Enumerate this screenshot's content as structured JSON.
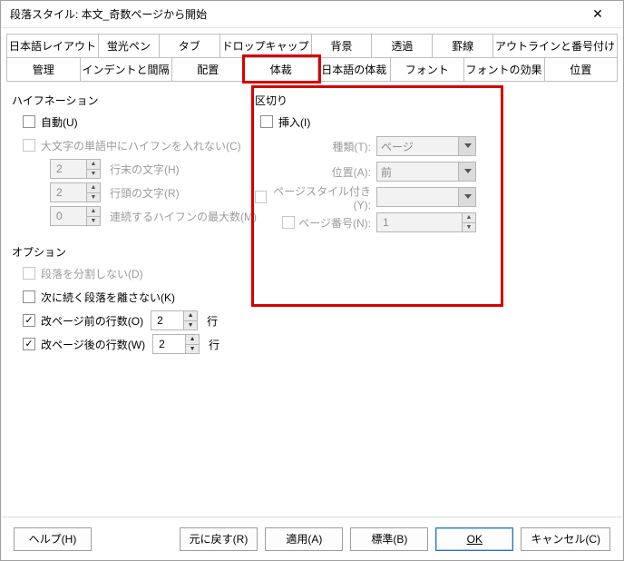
{
  "window": {
    "title": "段落スタイル: 本文_奇数ページから開始"
  },
  "tabs": {
    "row1": [
      "日本語レイアウト",
      "蛍光ペン",
      "タブ",
      "ドロップキャップ",
      "背景",
      "透過",
      "罫線",
      "アウトラインと番号付け"
    ],
    "row2": [
      "管理",
      "インデントと間隔",
      "配置",
      "体裁",
      "日本語の体裁",
      "フォント",
      "フォントの効果",
      "位置"
    ],
    "active_index": 3
  },
  "hyphenation": {
    "section": "ハイフネーション",
    "auto": {
      "label": "自動(U)",
      "checked": false
    },
    "no_caps": {
      "label": "大文字の単語中にハイフンを入れない(C)",
      "checked": false,
      "disabled": true
    },
    "end_chars": {
      "value": "2",
      "label": "行末の文字(H)"
    },
    "start_chars": {
      "value": "2",
      "label": "行頭の文字(R)"
    },
    "max_consec": {
      "value": "0",
      "label": "連続するハイフンの最大数(M)"
    }
  },
  "breaks": {
    "section": "区切り",
    "insert": {
      "label": "挿入(I)",
      "checked": false
    },
    "type": {
      "label": "種類(T):",
      "value": "ページ"
    },
    "position": {
      "label": "位置(A):",
      "value": "前"
    },
    "with_page_style": {
      "label": "ページスタイル付き(Y):",
      "checked": false,
      "value": ""
    },
    "page_number": {
      "label": "ページ番号(N):",
      "checked": false,
      "value": "1"
    }
  },
  "options": {
    "section": "オプション",
    "keep_together": {
      "label": "段落を分割しない(D)",
      "checked": false,
      "disabled": true
    },
    "keep_with_next": {
      "label": "次に続く段落を離さない(K)",
      "checked": false
    },
    "orphans": {
      "label": "改ページ前の行数(O)",
      "checked": true,
      "value": "2",
      "unit": "行"
    },
    "widows": {
      "label": "改ページ後の行数(W)",
      "checked": true,
      "value": "2",
      "unit": "行"
    }
  },
  "buttons": {
    "help": "ヘルプ(H)",
    "reset": "元に戻す(R)",
    "apply": "適用(A)",
    "standard": "標準(B)",
    "ok": "OK",
    "cancel": "キャンセル(C)"
  }
}
